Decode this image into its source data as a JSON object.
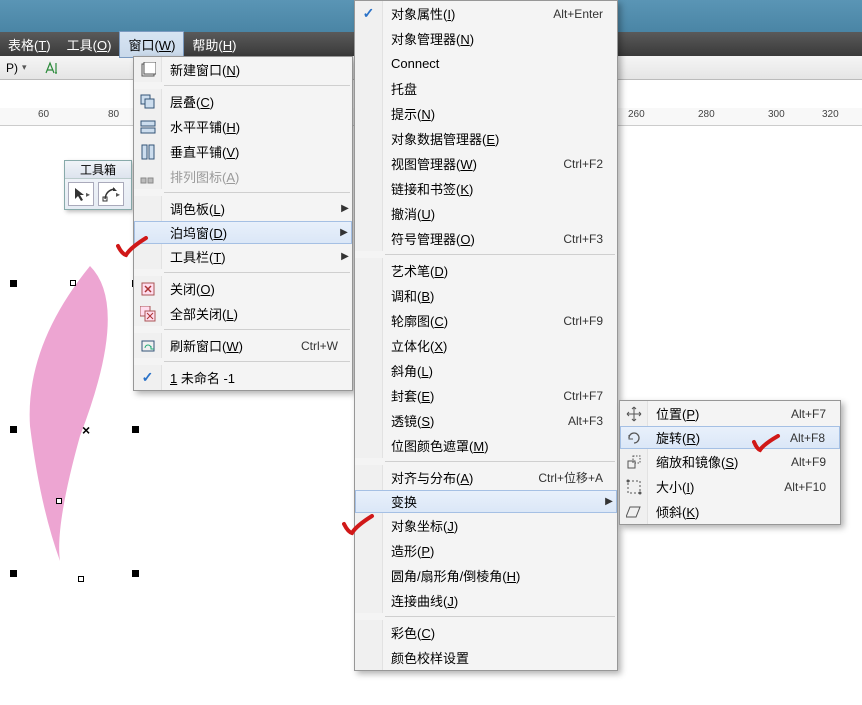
{
  "menubar": {
    "items": [
      {
        "pre": "表格(",
        "u": "T",
        "post": ")"
      },
      {
        "pre": "工具(",
        "u": "O",
        "post": ")"
      },
      {
        "pre": "窗口(",
        "u": "W",
        "post": ")"
      },
      {
        "pre": "帮助(",
        "u": "H",
        "post": ")"
      }
    ],
    "active_index": 2
  },
  "toolbar": {
    "dd_label": "P)"
  },
  "ruler_ticks": [
    "60",
    "80",
    "260",
    "280",
    "300",
    "320"
  ],
  "toolbox": {
    "title": "工具箱"
  },
  "menu1": [
    {
      "t": "item",
      "icon": "new",
      "pre": "新建窗口(",
      "u": "N",
      "post": ")"
    },
    {
      "t": "sep"
    },
    {
      "t": "item",
      "icon": "cascade",
      "pre": "层叠(",
      "u": "C",
      "post": ")"
    },
    {
      "t": "item",
      "icon": "tileh",
      "pre": "水平平铺(",
      "u": "H",
      "post": ")"
    },
    {
      "t": "item",
      "icon": "tilev",
      "pre": "垂直平铺(",
      "u": "V",
      "post": ")"
    },
    {
      "t": "item",
      "icon": "arrange",
      "pre": "排列图标(",
      "u": "A",
      "post": ")",
      "disabled": true
    },
    {
      "t": "sep"
    },
    {
      "t": "item",
      "icon": "",
      "pre": "调色板(",
      "u": "L",
      "post": ")",
      "sub": true
    },
    {
      "t": "item",
      "icon": "",
      "pre": "泊坞窗(",
      "u": "D",
      "post": ")",
      "sub": true,
      "highlight": true
    },
    {
      "t": "item",
      "icon": "",
      "pre": "工具栏(",
      "u": "T",
      "post": ")",
      "sub": true
    },
    {
      "t": "sep"
    },
    {
      "t": "item",
      "icon": "close",
      "pre": "关闭(",
      "u": "O",
      "post": ")"
    },
    {
      "t": "item",
      "icon": "closeall",
      "pre": "全部关闭(",
      "u": "L",
      "post": ")"
    },
    {
      "t": "sep"
    },
    {
      "t": "item",
      "icon": "refresh",
      "pre": "刷新窗口(",
      "u": "W",
      "post": ")",
      "shortcut": "Ctrl+W"
    },
    {
      "t": "sep"
    },
    {
      "t": "item",
      "icon": "check",
      "pre": "",
      "u": "1",
      "post": " 未命名 -1"
    }
  ],
  "menu2": [
    {
      "t": "item",
      "icon": "check",
      "pre": "对象属性(",
      "u": "I",
      "post": ")",
      "shortcut": "Alt+Enter"
    },
    {
      "t": "item",
      "pre": "对象管理器(",
      "u": "N",
      "post": ")"
    },
    {
      "t": "item",
      "plain": "Connect"
    },
    {
      "t": "item",
      "plain": "托盘"
    },
    {
      "t": "item",
      "pre": "提示(",
      "u": "N",
      "post": ")"
    },
    {
      "t": "item",
      "pre": "对象数据管理器(",
      "u": "E",
      "post": ")"
    },
    {
      "t": "item",
      "pre": "视图管理器(",
      "u": "W",
      "post": ")",
      "shortcut": "Ctrl+F2"
    },
    {
      "t": "item",
      "pre": "链接和书签(",
      "u": "K",
      "post": ")"
    },
    {
      "t": "item",
      "pre": "撤消(",
      "u": "U",
      "post": ")"
    },
    {
      "t": "item",
      "pre": "符号管理器(",
      "u": "O",
      "post": ")",
      "shortcut": "Ctrl+F3"
    },
    {
      "t": "sep"
    },
    {
      "t": "item",
      "pre": "艺术笔(",
      "u": "D",
      "post": ")"
    },
    {
      "t": "item",
      "pre": "调和(",
      "u": "B",
      "post": ")"
    },
    {
      "t": "item",
      "pre": "轮廓图(",
      "u": "C",
      "post": ")",
      "shortcut": "Ctrl+F9"
    },
    {
      "t": "item",
      "pre": "立体化(",
      "u": "X",
      "post": ")"
    },
    {
      "t": "item",
      "pre": "斜角(",
      "u": "L",
      "post": ")"
    },
    {
      "t": "item",
      "pre": "封套(",
      "u": "E",
      "post": ")",
      "shortcut": "Ctrl+F7"
    },
    {
      "t": "item",
      "pre": "透镜(",
      "u": "S",
      "post": ")",
      "shortcut": "Alt+F3"
    },
    {
      "t": "item",
      "pre": "位图颜色遮罩(",
      "u": "M",
      "post": ")"
    },
    {
      "t": "sep"
    },
    {
      "t": "item",
      "pre": "对齐与分布(",
      "u": "A",
      "post": ")",
      "shortcut": "Ctrl+位移+A"
    },
    {
      "t": "item",
      "plain": "变换",
      "sub": true,
      "highlight": true
    },
    {
      "t": "item",
      "pre": "对象坐标(",
      "u": "J",
      "post": ")"
    },
    {
      "t": "item",
      "pre": "造形(",
      "u": "P",
      "post": ")"
    },
    {
      "t": "item",
      "pre": "圆角/扇形角/倒棱角(",
      "u": "H",
      "post": ")"
    },
    {
      "t": "item",
      "pre": "连接曲线(",
      "u": "J",
      "post": ")"
    },
    {
      "t": "sep"
    },
    {
      "t": "item",
      "pre": "彩色(",
      "u": "C",
      "post": ")"
    },
    {
      "t": "item",
      "plain": "颜色校样设置"
    }
  ],
  "menu3": [
    {
      "t": "item",
      "icon": "move",
      "pre": "位置(",
      "u": "P",
      "post": ")",
      "shortcut": "Alt+F7"
    },
    {
      "t": "item",
      "icon": "rotate",
      "pre": "旋转(",
      "u": "R",
      "post": ")",
      "shortcut": "Alt+F8",
      "highlight": true
    },
    {
      "t": "item",
      "icon": "scale",
      "pre": "缩放和镜像(",
      "u": "S",
      "post": ")",
      "shortcut": "Alt+F9"
    },
    {
      "t": "item",
      "icon": "size",
      "pre": "大小(",
      "u": "I",
      "post": ")",
      "shortcut": "Alt+F10"
    },
    {
      "t": "item",
      "icon": "skew",
      "pre": "倾斜(",
      "u": "K",
      "post": ")"
    }
  ]
}
